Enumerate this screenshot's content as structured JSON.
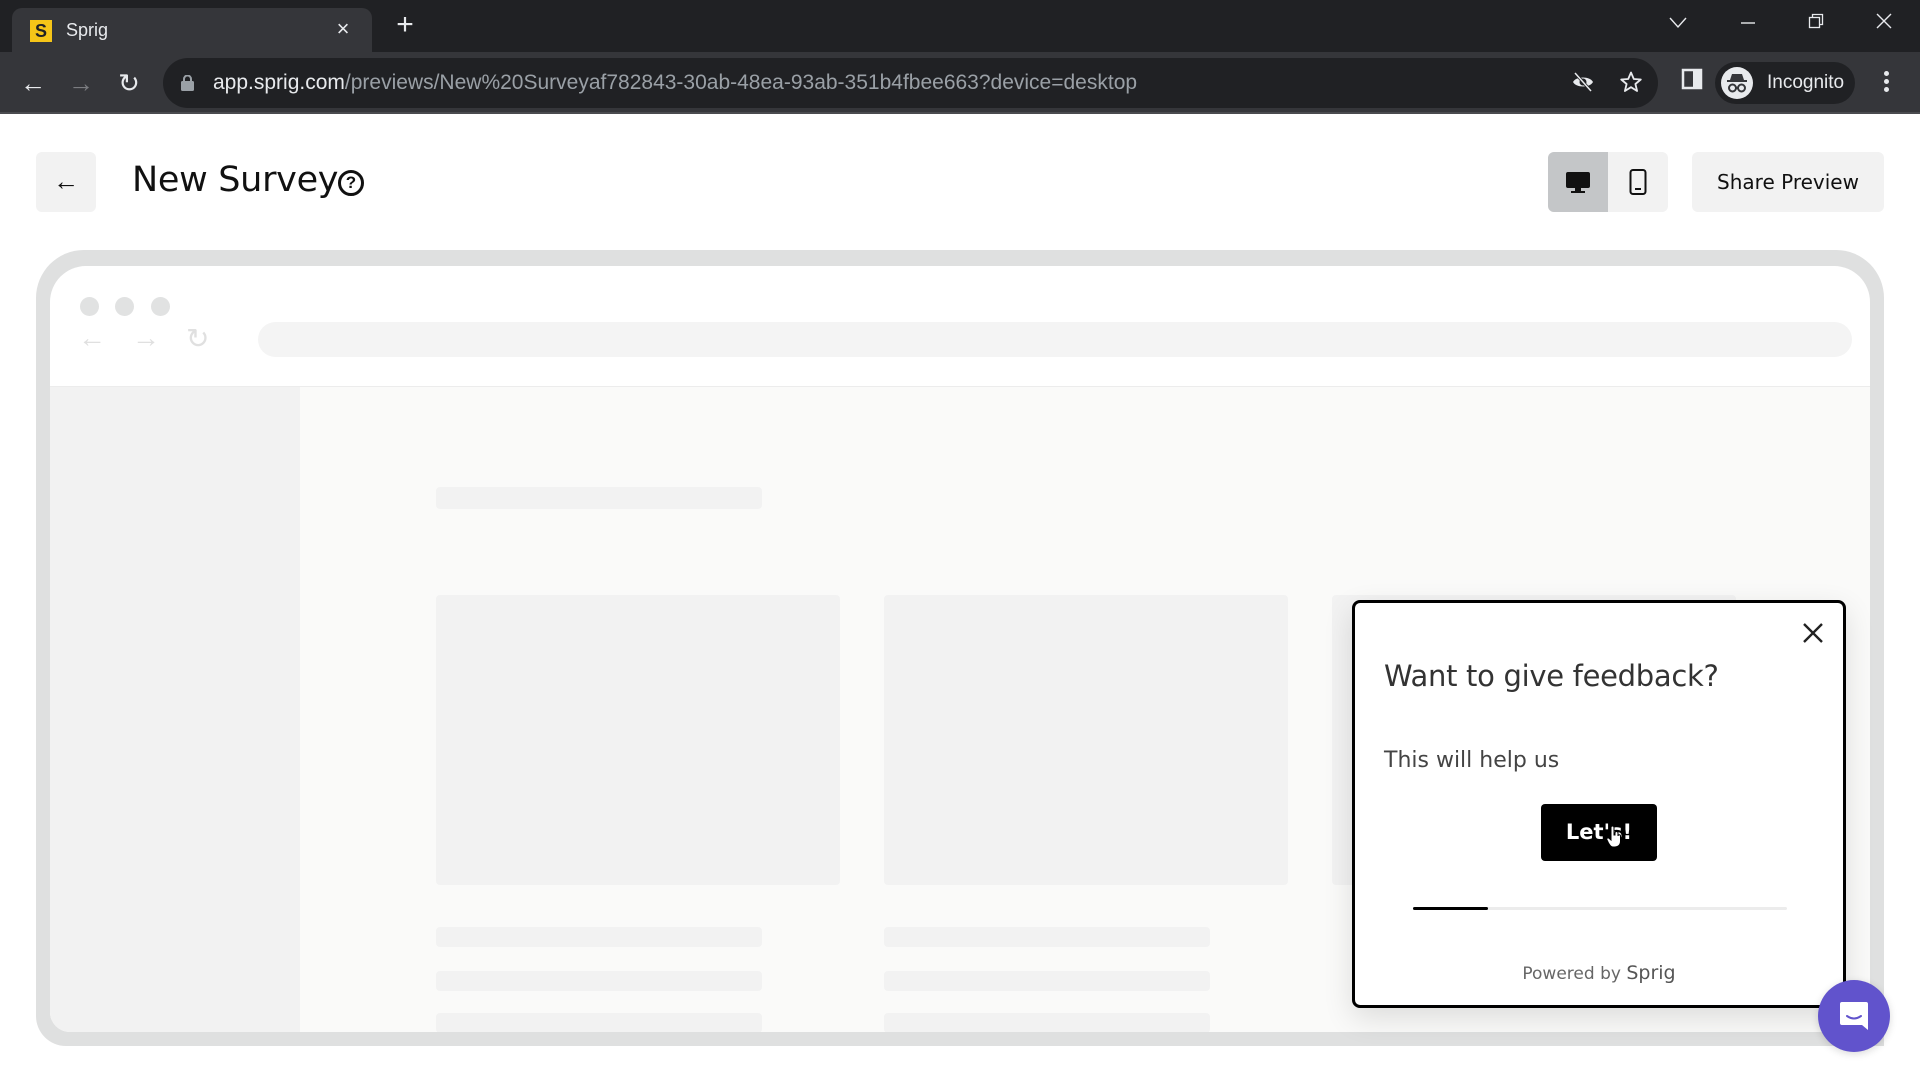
{
  "browser": {
    "tab": {
      "favicon_letter": "S",
      "title": "Sprig",
      "close_glyph": "×"
    },
    "new_tab_glyph": "+",
    "window_controls": {
      "tab_search": "⌵",
      "minimize": "—",
      "restore": "❐",
      "close": "✕"
    },
    "toolbar": {
      "back_glyph": "←",
      "forward_glyph": "→",
      "reload_glyph": "↻",
      "url_host": "app.sprig.com",
      "url_path": "/previews/New%20Surveyaf782843-30ab-48ea-93ab-351b4fbee663?device=desktop",
      "profile_label": "Incognito"
    },
    "icons": [
      "lock-icon",
      "eye-off-icon",
      "star-icon",
      "side-panel-icon",
      "incognito-icon",
      "kebab-menu-icon"
    ]
  },
  "header": {
    "back_glyph": "←",
    "title": "New Survey",
    "help_glyph": "?",
    "device_toggle": {
      "options": [
        "desktop",
        "mobile"
      ],
      "selected": "desktop"
    },
    "share_label": "Share Preview"
  },
  "mock_browser": {
    "nav": {
      "back": "←",
      "forward": "→",
      "reload": "↻"
    }
  },
  "survey": {
    "title": "Want to give feedback?",
    "description": "This will help us",
    "cta_label": "Let's!",
    "progress_percent": 20,
    "powered_by_prefix": "Powered by",
    "powered_by_brand": "Sprig"
  },
  "colors": {
    "favicon": "#f5c518",
    "survey_button": "#000000",
    "intercom": "#6153cc",
    "device_active": "#c4c6c8"
  }
}
